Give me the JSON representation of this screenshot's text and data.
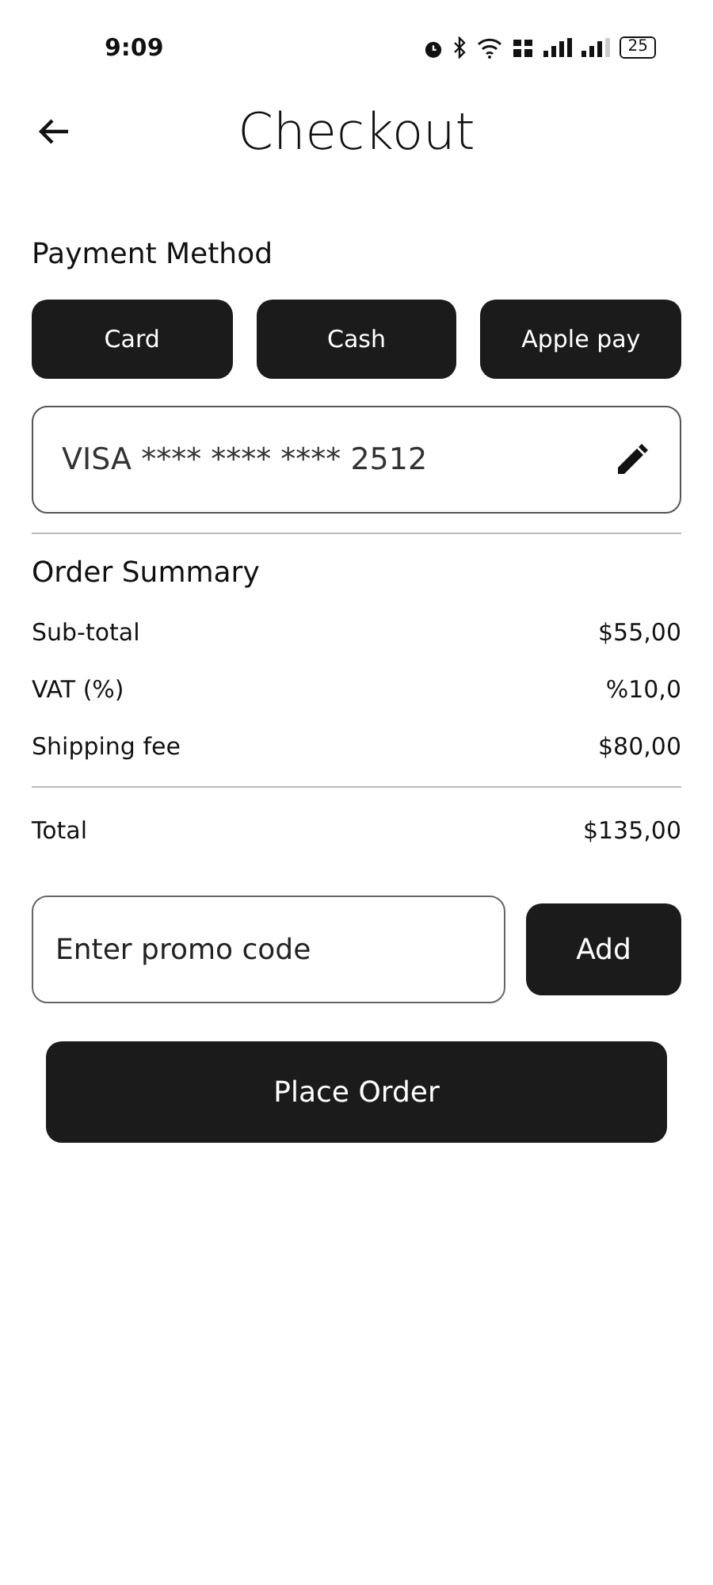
{
  "status_bar": {
    "time": "9:09",
    "battery": "25"
  },
  "header": {
    "title": "Checkout"
  },
  "payment": {
    "heading": "Payment Method",
    "methods": [
      "Card",
      "Cash",
      "Apple pay"
    ],
    "card": {
      "brand": "VISA",
      "mask": "**** **** ****",
      "last4": "2512"
    }
  },
  "summary": {
    "heading": "Order Summary",
    "rows": [
      {
        "label": "Sub-total",
        "value": "$55,00"
      },
      {
        "label": "VAT (%)",
        "value": "%10,0"
      },
      {
        "label": "Shipping fee",
        "value": "$80,00"
      }
    ],
    "total": {
      "label": "Total",
      "value": "$135,00"
    }
  },
  "promo": {
    "placeholder": "Enter promo code",
    "button": "Add"
  },
  "place_order": "Place Order"
}
